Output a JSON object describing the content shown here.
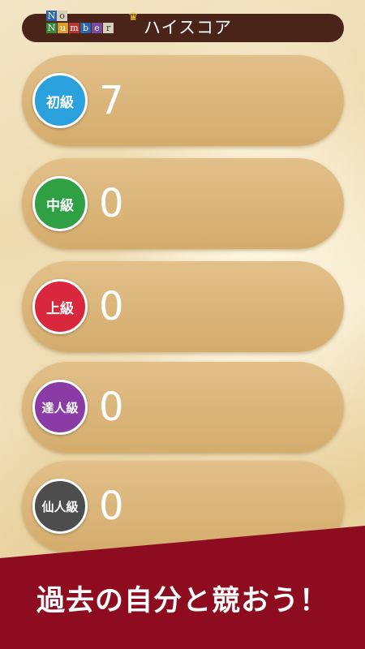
{
  "header": {
    "logo_letters": [
      "N",
      "o",
      "N",
      "u",
      "m",
      "b",
      "e",
      "r"
    ],
    "title": "ハイスコア"
  },
  "levels": [
    {
      "label": "初級",
      "score": "7",
      "color": "#2aa0dc"
    },
    {
      "label": "中級",
      "score": "0",
      "color": "#2fa044"
    },
    {
      "label": "上級",
      "score": "0",
      "color": "#d9283d"
    },
    {
      "label": "達人級",
      "score": "0",
      "color": "#8a3ba6"
    },
    {
      "label": "仙人級",
      "score": "0",
      "color": "#4d4d4d"
    }
  ],
  "banner": {
    "text": "過去の自分と競おう！",
    "color": "#8e0c1f"
  }
}
